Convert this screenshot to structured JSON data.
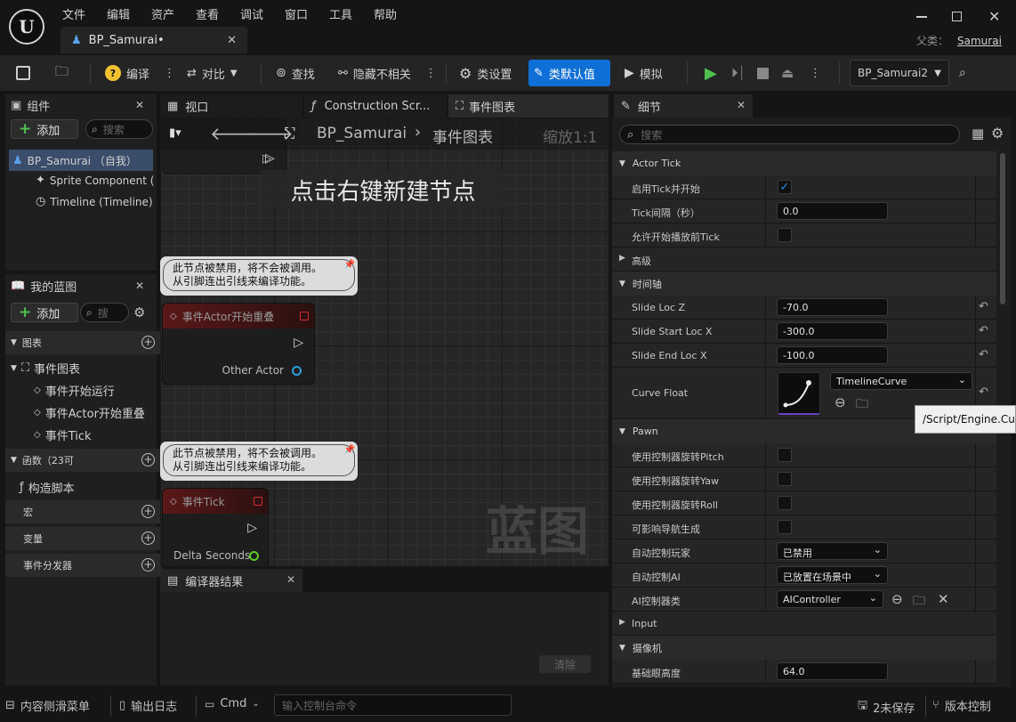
{
  "menu": [
    "文件",
    "编辑",
    "资产",
    "查看",
    "调试",
    "窗口",
    "工具",
    "帮助"
  ],
  "doc_tab": "BP_Samurai•",
  "parent": {
    "label": "父类：",
    "value": "Samurai"
  },
  "toolbar": {
    "compile": "编译",
    "diff": "对比",
    "find": "查找",
    "hide_unrelated": "隐藏不相关",
    "class_settings": "类设置",
    "class_defaults": "类默认值",
    "simulate": "模拟",
    "debug_object": "BP_Samurai2"
  },
  "components": {
    "title": "组件",
    "add": "添加",
    "search_placeholder": "搜索",
    "items": [
      "BP_Samurai （自我）",
      "Sprite Component (",
      "Timeline (Timeline)"
    ]
  },
  "my_blueprint": {
    "title": "我的蓝图",
    "add": "添加",
    "search_placeholder": "搜",
    "graphs": "图表",
    "event_graph": "事件图表",
    "events": [
      "事件开始运行",
      "事件Actor开始重叠",
      "事件Tick"
    ],
    "functions": "函数（23可",
    "construction": "构造脚本",
    "macros": "宏",
    "variables": "变量",
    "dispatchers": "事件分发器"
  },
  "editor_tabs": {
    "viewport": "视口",
    "construction": "Construction Scr...",
    "event_graph": "事件图表",
    "details": "细节"
  },
  "graph": {
    "breadcrumb_root": "BP_Samurai",
    "breadcrumb_leaf": "事件图表",
    "zoom": "缩放1:1",
    "hint": "点击右键新建节点",
    "comment_line1": "此节点被禁用，将不会被调用。",
    "comment_line2": "从引脚连出引线来编译功能。",
    "node_overlap": "事件Actor开始重叠",
    "node_overlap_pin": "Other Actor",
    "node_tick": "事件Tick",
    "node_tick_pin": "Delta Seconds",
    "watermark": "蓝图"
  },
  "compiler": {
    "title": "编译器结果",
    "clear": "清除"
  },
  "details": {
    "search_placeholder": "搜索",
    "sections": {
      "actor_tick": "Actor Tick",
      "advanced": "高级",
      "timeline": "时间轴",
      "pawn": "Pawn",
      "input": "Input",
      "camera": "摄像机"
    },
    "tick_enabled": "启用Tick并开始",
    "tick_interval": "Tick间隔（秒）",
    "tick_interval_value": "0.0",
    "tick_before_begin": "允许开始播放前Tick",
    "slide_loc_z": "Slide Loc Z",
    "slide_loc_z_value": "-70.0",
    "slide_start_x": "Slide Start Loc X",
    "slide_start_x_value": "-300.0",
    "slide_end_x": "Slide End Loc X",
    "slide_end_x_value": "-100.0",
    "curve_float": "Curve Float",
    "curve_value": "TimelineCurve",
    "tooltip": "/Script/Engine.Curv",
    "pitch": "使用控制器旋转Pitch",
    "yaw": "使用控制器旋转Yaw",
    "roll": "使用控制器旋转Roll",
    "nav": "可影响导航生成",
    "auto_possess_player": "自动控制玩家",
    "auto_possess_player_value": "已禁用",
    "auto_possess_ai": "自动控制AI",
    "auto_possess_ai_value": "已放置在场景中",
    "ai_controller_class": "AI控制器类",
    "ai_controller_value": "AIController",
    "base_eye_height": "基础眼高度",
    "base_eye_height_value": "64.0"
  },
  "statusbar": {
    "content_drawer": "内容侧滑菜单",
    "output_log": "输出日志",
    "cmd": "Cmd",
    "console_placeholder": "输入控制台命令",
    "unsaved": "2未保存",
    "source_control": "版本控制"
  },
  "colors": {
    "accent": "#0e6fd6",
    "play": "#4fc14f",
    "pin_red": "#d03030",
    "pin_blue": "#2aa0e0",
    "pin_green": "#5acb2a"
  }
}
